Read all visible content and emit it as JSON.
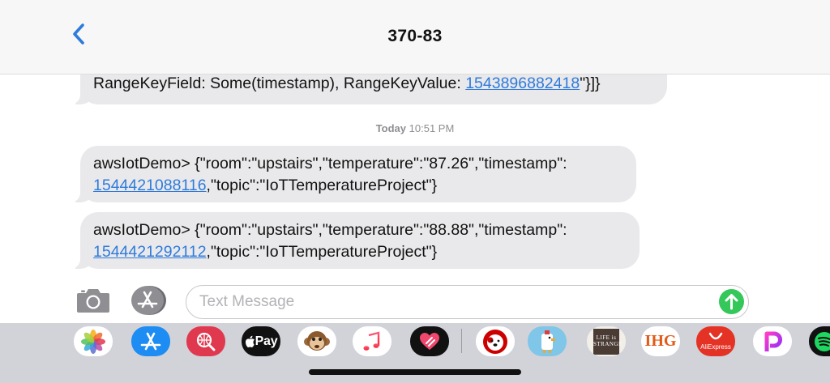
{
  "header": {
    "title": "370-83"
  },
  "messages": [
    {
      "line2_prefix": "RangeKeyField: Some(timestamp), RangeKeyValue: ",
      "line2_link": "1543896882418",
      "line2_suffix": "\"}]}"
    },
    {
      "line1": "awsIotDemo> {\"room\":\"upstairs\",\"temperature\":\"87.26\",\"timestamp\":",
      "line2_link": "1544421088116",
      "line2_suffix": ",\"topic\":\"IoTTemperatureProject\"}"
    },
    {
      "line1": "awsIotDemo> {\"room\":\"upstairs\",\"temperature\":\"88.88\",\"timestamp\":",
      "line2_link": "1544421292112",
      "line2_suffix": ",\"topic\":\"IoTTemperatureProject\"}"
    }
  ],
  "timestamp": {
    "day": "Today",
    "time": "10:51 PM"
  },
  "input": {
    "placeholder": "Text Message"
  },
  "drawer": {
    "apple_pay_label": "Pay",
    "ihg_label": "IHG",
    "aliexpress_label": "AliExpress",
    "life_is_strange_label": "LIFE is STRANGE"
  },
  "colors": {
    "accent": "#2f7bdb",
    "bubble": "#e9e9eb",
    "send": "#34c759",
    "drawer": "#d1d3d9"
  }
}
